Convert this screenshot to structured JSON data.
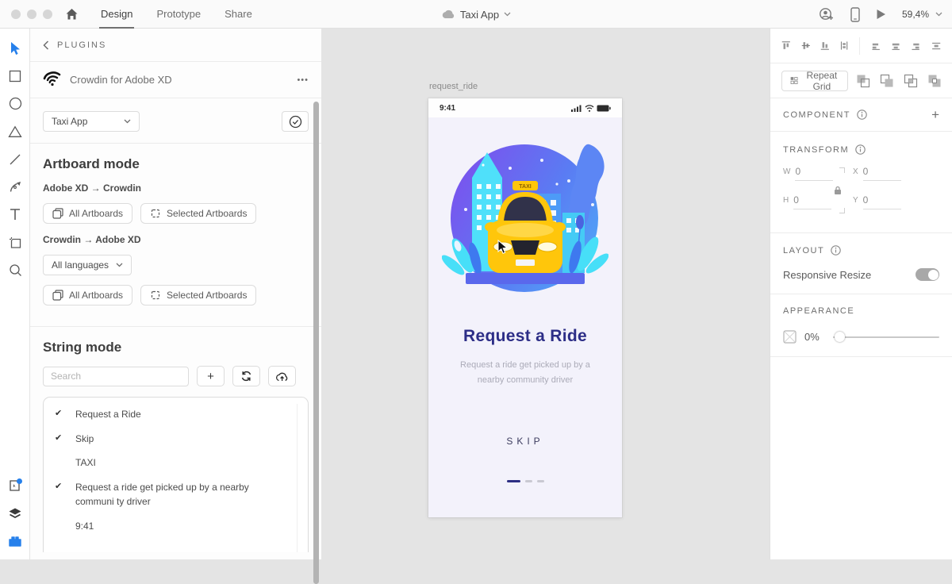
{
  "colors": {
    "accent_blue": "#2680EB",
    "title_indigo": "#2D2E87",
    "taxi_yellow": "#FFC60B"
  },
  "topbar": {
    "tabs": [
      {
        "label": "Design"
      },
      {
        "label": "Prototype"
      },
      {
        "label": "Share"
      }
    ],
    "document_title": "Taxi App",
    "zoom_level": "59,4%"
  },
  "plugins_panel": {
    "header": "PLUGINS",
    "plugin_title": "Crowdin for Adobe XD",
    "more_icon": "•••",
    "project_select": "Taxi App",
    "artboard_mode": {
      "title": "Artboard mode",
      "xd_to_crowdin": "Adobe XD → Crowdin",
      "crowdin_to_xd": "Crowdin → Adobe XD",
      "all_artboards": "All Artboards",
      "selected_artboards": "Selected Artboards",
      "languages_select": "All languages"
    },
    "string_mode": {
      "title": "String mode",
      "search_placeholder": "Search",
      "add_label": "+",
      "strings": [
        {
          "check": "✔",
          "text": "Request a Ride"
        },
        {
          "check": "✔",
          "text": "Skip"
        },
        {
          "check": "",
          "text": "TAXI"
        },
        {
          "check": "✔",
          "text": "Request a ride get picked up by a nearby communi ty driver"
        },
        {
          "check": "",
          "text": "9:41"
        }
      ]
    }
  },
  "canvas": {
    "artboard_name": "request_ride",
    "phone": {
      "status_time": "9:41",
      "taxi_sign": "TAXI",
      "title": "Request a Ride",
      "subtitle": "Request a ride get picked up by a nearby community driver",
      "skip": "SKIP"
    }
  },
  "right_panel": {
    "repeat_grid": "Repeat Grid",
    "component_title": "COMPONENT",
    "add_component": "+",
    "transform": {
      "title": "TRANSFORM",
      "w_label": "W",
      "x_label": "X",
      "h_label": "H",
      "y_label": "Y",
      "w": "0",
      "x": "0",
      "h": "0",
      "y": "0"
    },
    "layout_title": "LAYOUT",
    "responsive_resize": "Responsive Resize",
    "appearance_title": "APPEARANCE",
    "opacity": "0%"
  }
}
